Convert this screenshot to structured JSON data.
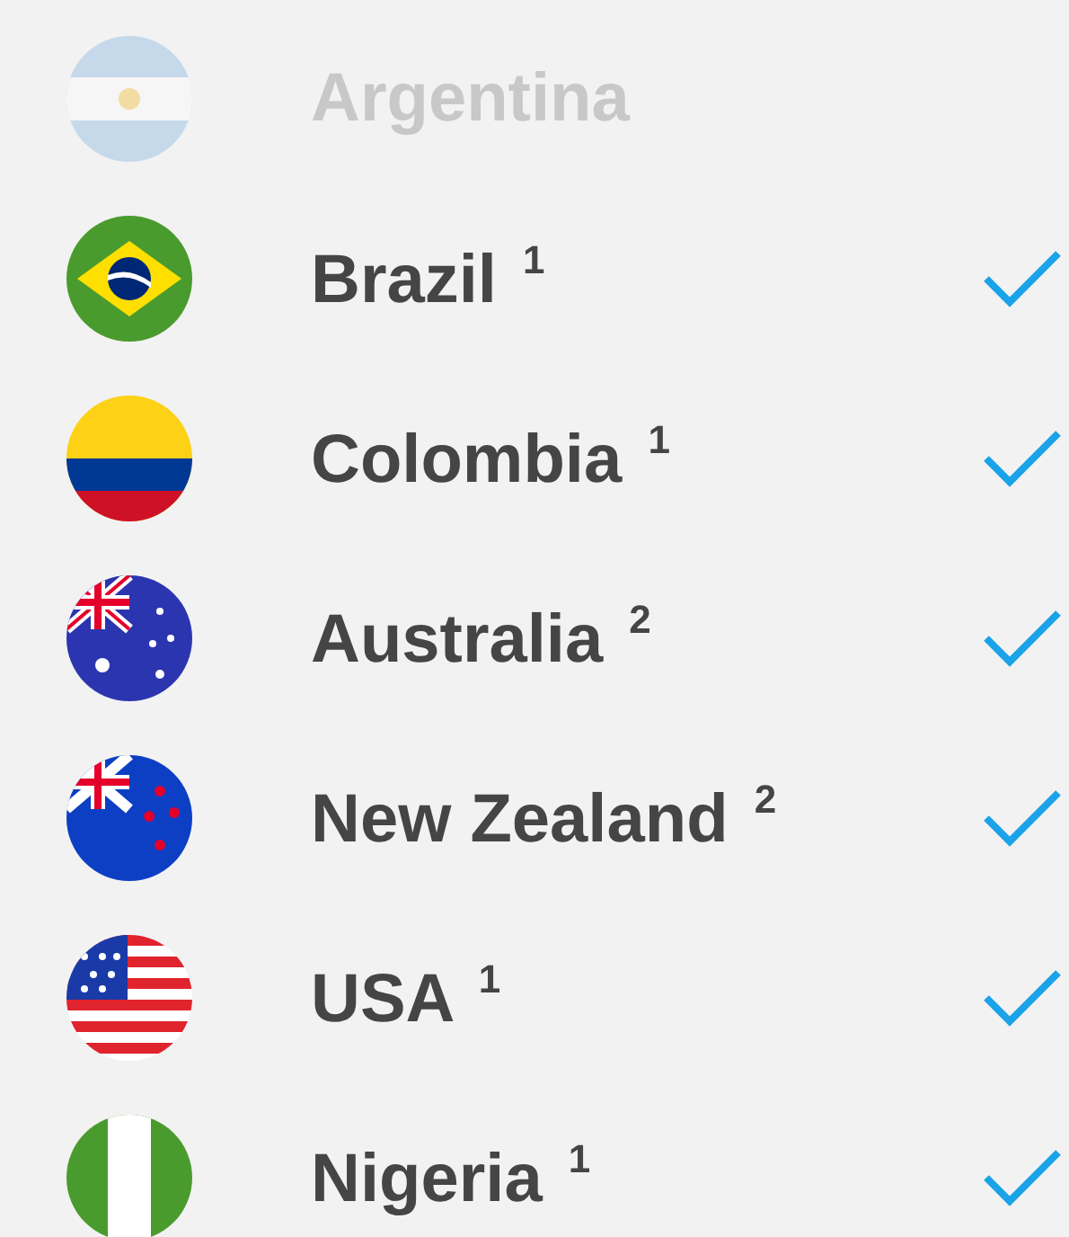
{
  "countries": [
    {
      "name": "Argentina",
      "disabled": true,
      "checked": false
    },
    {
      "name": "Brazil $^{1}$",
      "disabled": false,
      "checked": true
    },
    {
      "name": "Colombia $^{1}$",
      "disabled": false,
      "checked": true
    },
    {
      "name": "Australia $^{2}$",
      "disabled": false,
      "checked": true
    },
    {
      "name": "New Zealand $^{2}$",
      "disabled": false,
      "checked": true
    },
    {
      "name": "USA $^{1}$",
      "disabled": false,
      "checked": true
    },
    {
      "name": "Nigeria $^{1}$",
      "disabled": false,
      "checked": true
    }
  ]
}
